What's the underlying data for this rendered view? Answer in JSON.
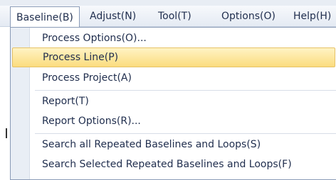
{
  "menubar": {
    "items": [
      {
        "label": "Baseline(B)",
        "active": true
      },
      {
        "label": "Adjust(N)"
      },
      {
        "label": "Tool(T)"
      },
      {
        "label": "Options(O)"
      },
      {
        "label": "Help(H)"
      }
    ]
  },
  "dropdown": {
    "items": [
      {
        "label": "Process Options(O)..."
      },
      {
        "label": "Process Line(P)",
        "highlighted": true
      },
      {
        "label": "Process Project(A)"
      },
      {
        "label": "Report(T)"
      },
      {
        "label": "Report Options(R)..."
      },
      {
        "label": "Search all Repeated Baselines and Loops(S)"
      },
      {
        "label": "Search Selected Repeated Baselines and Loops(F)"
      }
    ]
  },
  "colors": {
    "menu_text": "#1f2d4d",
    "highlight_top": "#fff3c4",
    "highlight_bottom": "#fbdc7e",
    "border": "#8a9bb7",
    "gutter": "#e9eef5"
  }
}
